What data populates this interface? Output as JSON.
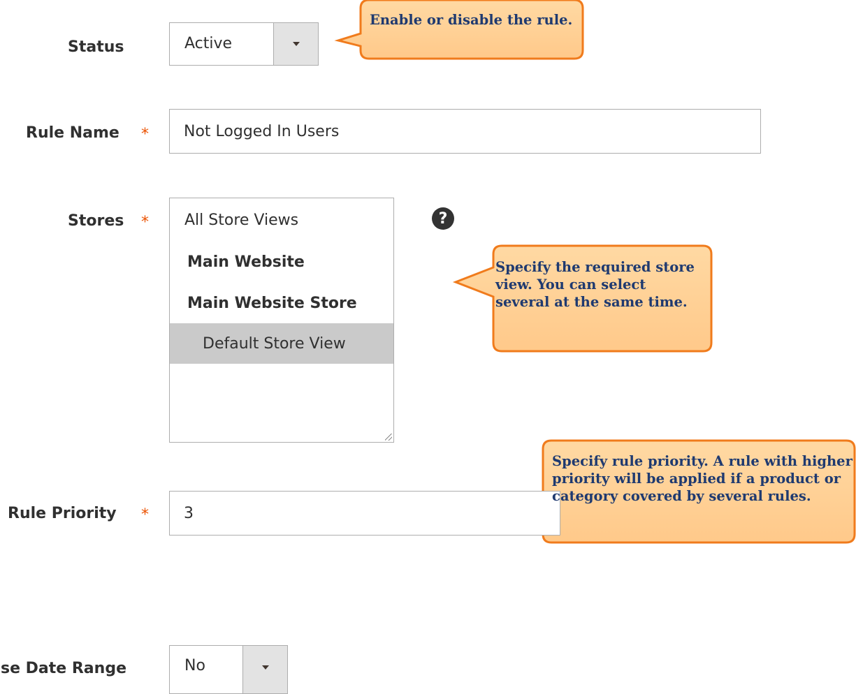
{
  "status": {
    "label": "Status",
    "value": "Active"
  },
  "rule_name": {
    "label": "Rule Name",
    "value": "Not Logged In Users",
    "required_mark": "*"
  },
  "stores": {
    "label": "Stores",
    "required_mark": "*",
    "help_icon_glyph": "?",
    "options": [
      {
        "text": "All Store Views"
      },
      {
        "text": "Main Website"
      },
      {
        "text": "Main Website Store"
      },
      {
        "text": "Default Store View"
      }
    ]
  },
  "rule_priority": {
    "label": "Rule Priority",
    "value": "3",
    "required_mark": "*"
  },
  "use_date_range": {
    "label": "Use Date Range",
    "value": "No"
  },
  "callouts": {
    "status": "Enable or disable the rule.",
    "stores": "Specify the required store view. You can select several at the same time.",
    "priority": "Specify rule priority. A rule with higher priority  will be applied if a product or category covered by  several rules."
  },
  "colors": {
    "callout_fill": "#ffd08f",
    "callout_border": "#f07b1c",
    "callout_text": "#1f3a70",
    "required": "#eb5202"
  }
}
